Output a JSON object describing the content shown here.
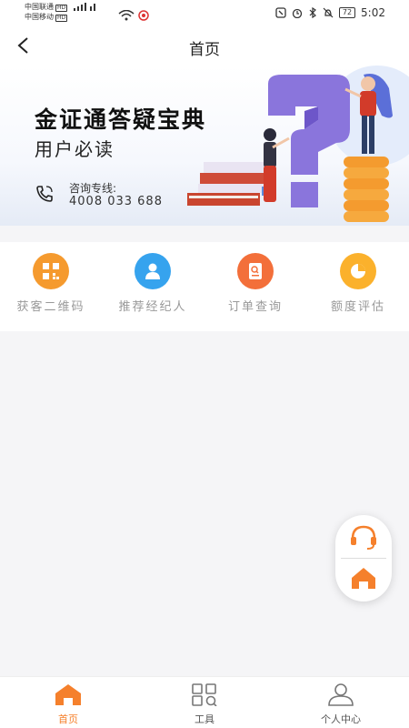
{
  "status_bar": {
    "carrier1": "中国联通",
    "carrier2": "中国移动",
    "hd": "HD",
    "battery": "72",
    "time": "5:02"
  },
  "header": {
    "title": "首页",
    "back_icon": "chevron-left-icon"
  },
  "banner": {
    "title": "金证通答疑宝典",
    "subtitle": "用户必读",
    "hotline_label": "咨询专线:",
    "hotline_number": "4008 033 688",
    "phone_icon": "phone-icon"
  },
  "quick_actions": [
    {
      "label": "获客二维码",
      "icon": "qrcode-icon",
      "color": "#f59a2e"
    },
    {
      "label": "推荐经纪人",
      "icon": "user-icon",
      "color": "#36a3ee"
    },
    {
      "label": "订单查询",
      "icon": "document-search-icon",
      "color": "#f36f3a"
    },
    {
      "label": "额度评估",
      "icon": "pie-chart-icon",
      "color": "#fbb12c"
    }
  ],
  "floating": {
    "support_icon": "headset-icon",
    "home_icon": "home-icon"
  },
  "tabs": [
    {
      "label": "首页",
      "icon": "home-icon",
      "active": true
    },
    {
      "label": "工具",
      "icon": "grid-icon",
      "active": false
    },
    {
      "label": "个人中心",
      "icon": "person-icon",
      "active": false
    }
  ],
  "colors": {
    "accent": "#f5802c",
    "inactive": "#777777"
  }
}
